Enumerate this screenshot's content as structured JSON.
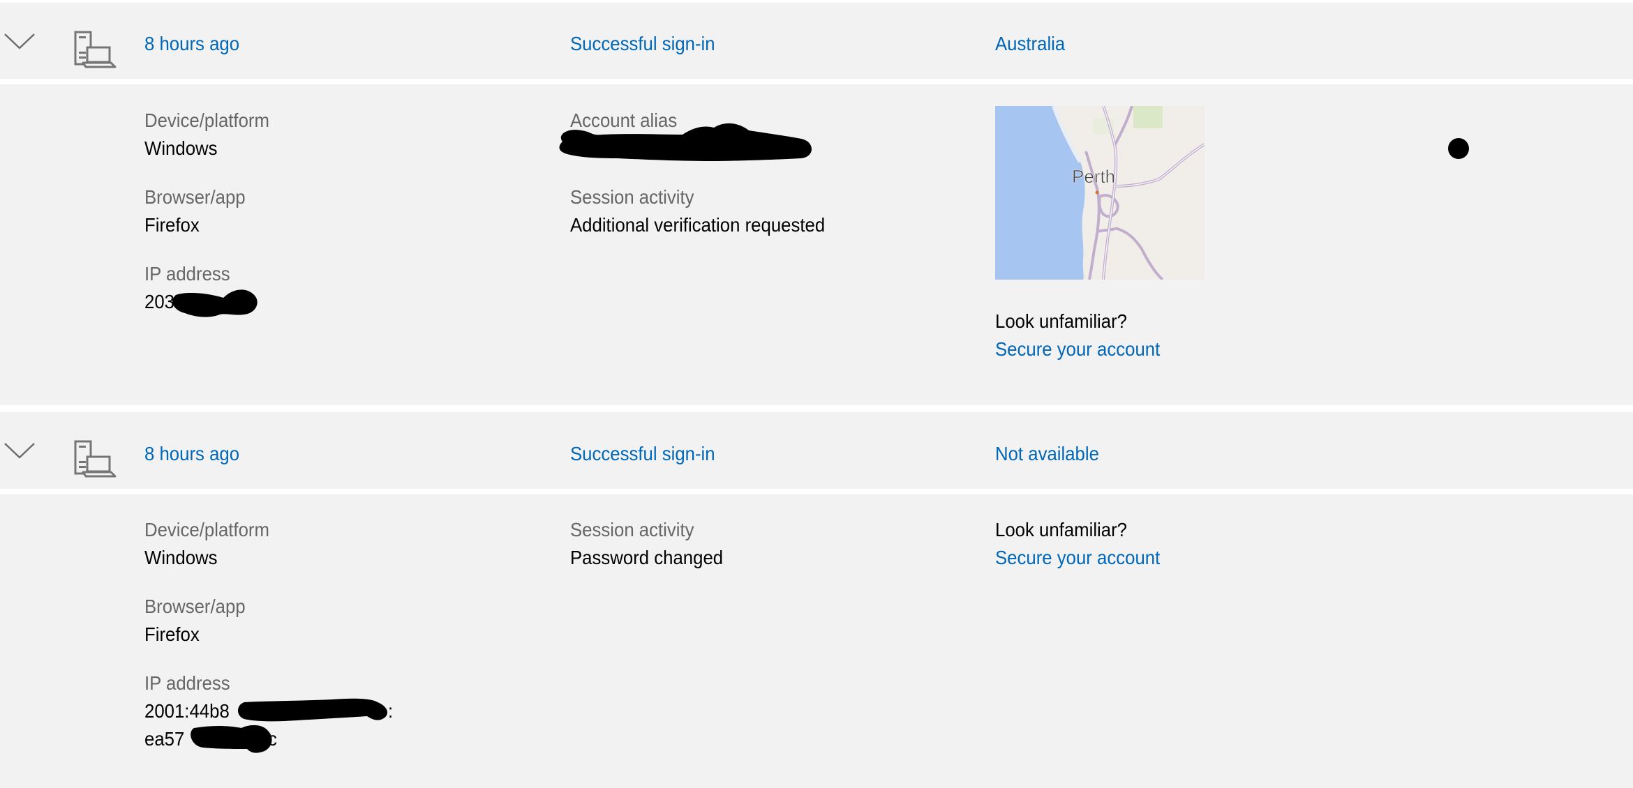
{
  "colors": {
    "panel_bg": "#f2f2f2",
    "link": "#0067b8",
    "label": "#666666",
    "value": "#000000"
  },
  "activities": [
    {
      "expanded": true,
      "icon": "desktop-laptop-icon",
      "time": "8 hours ago",
      "event": "Successful sign-in",
      "location": "Australia",
      "details": {
        "device_label": "Device/platform",
        "device_value": "Windows",
        "browser_label": "Browser/app",
        "browser_value": "Firefox",
        "ip_label": "IP address",
        "ip_value": "203",
        "alias_label": "Account alias",
        "alias_value": "",
        "session_label": "Session activity",
        "session_value": "Additional verification requested",
        "map_city": "Perth",
        "unfamiliar_text": "Look unfamiliar?",
        "secure_link": "Secure your account"
      }
    },
    {
      "expanded": true,
      "icon": "desktop-laptop-icon",
      "time": "8 hours ago",
      "event": "Successful sign-in",
      "location": "Not available",
      "details": {
        "device_label": "Device/platform",
        "device_value": "Windows",
        "browser_label": "Browser/app",
        "browser_value": "Firefox",
        "ip_label": "IP address",
        "ip_value_line1": "2001:44b8",
        "ip_value_line1_end": ":",
        "ip_value_line2": "ea57",
        "ip_value_line2_end": "c",
        "session_label": "Session activity",
        "session_value": "Password changed",
        "unfamiliar_text": "Look unfamiliar?",
        "secure_link": "Secure your account"
      }
    }
  ]
}
